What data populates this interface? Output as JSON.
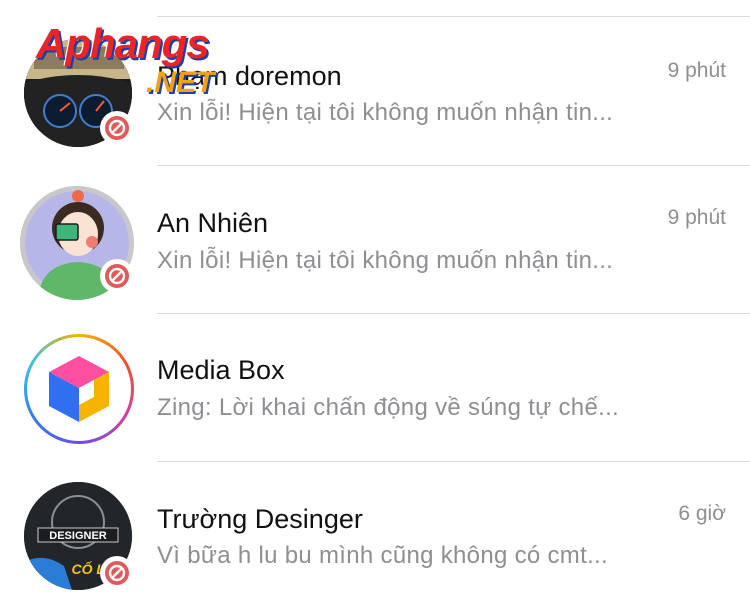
{
  "conversations": [
    {
      "name": "Phạm doremon",
      "preview": "Xin lỗi! Hiện tại tôi không muốn nhận tin...",
      "time": "9 phút",
      "blocked": true,
      "avatar_icon": "car-dashboard-photo"
    },
    {
      "name": "An Nhiên",
      "preview": "Xin lỗi! Hiện tại tôi không muốn nhận tin...",
      "time": "9 phút",
      "blocked": true,
      "avatar_icon": "girl-illustration-avatar"
    },
    {
      "name": "Media Box",
      "preview": "Zing: Lời khai chấn động về súng tự chế...",
      "time": "",
      "blocked": false,
      "avatar_icon": "media-box-cube-logo"
    },
    {
      "name": "Trường Desinger",
      "preview": "Vì bữa h lu bu mình cũng không có cmt...",
      "time": "6 giờ",
      "blocked": true,
      "avatar_icon": "designer-logo-avatar"
    }
  ],
  "watermark": {
    "main": "Aphangs",
    "sub": ".NET"
  },
  "colors": {
    "blocked_badge": "#e05a5a",
    "secondary_text": "#8e8e93",
    "primary_text": "#111111",
    "divider": "#dcdcdf"
  }
}
